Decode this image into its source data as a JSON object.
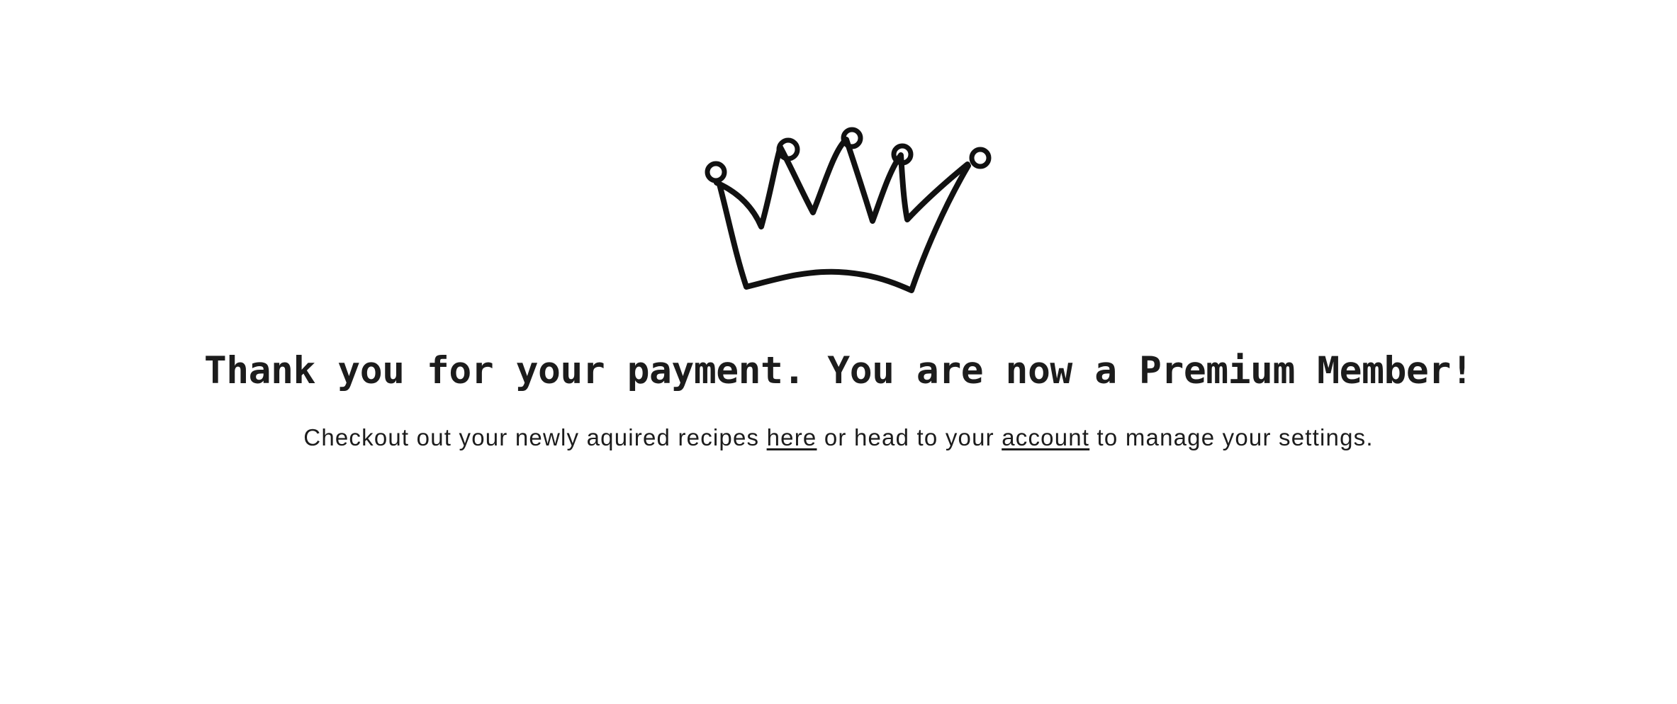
{
  "logo": {
    "icon": "crown-icon",
    "color": "#111111"
  },
  "headline": "Thank you for your payment. You are now a Premium Member!",
  "message": {
    "before_link1": "Checkout out your newly aquired recipes ",
    "link1_label": "here",
    "between_links": " or head to your ",
    "link2_label": "account",
    "after_link2": " to manage your settings."
  },
  "colors": {
    "background": "#ffffff",
    "text": "#1c1c1c"
  }
}
